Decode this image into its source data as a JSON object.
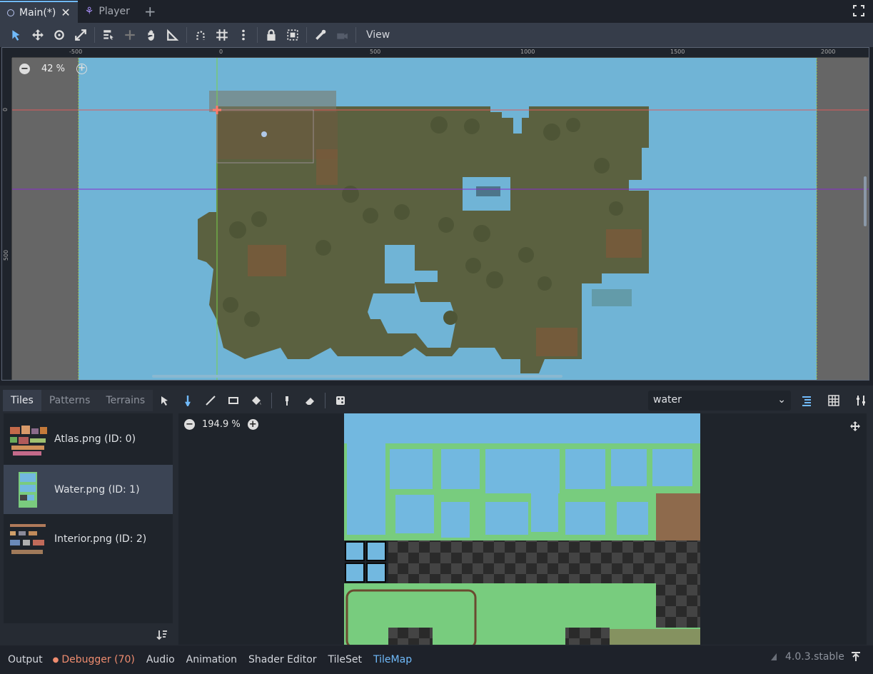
{
  "editor_tabs": {
    "main": "Main(*)",
    "player": "Player"
  },
  "toolbar": {
    "view_label": "View"
  },
  "viewport": {
    "zoom": "42 %",
    "ruler_h": [
      "-500",
      "0",
      "500",
      "1000",
      "1500",
      "2000"
    ],
    "ruler_v": [
      "0",
      "500"
    ]
  },
  "tilemap_panel": {
    "tabs": [
      "Tiles",
      "Patterns",
      "Terrains"
    ],
    "terrain_select": "water",
    "sources": [
      {
        "label": "Atlas.png (ID: 0)"
      },
      {
        "label": "Water.png (ID: 1)"
      },
      {
        "label": "Interior.png (ID: 2)"
      }
    ],
    "atlas_zoom": "194.9 %"
  },
  "bottom_bar": {
    "items": [
      "Output",
      "Debugger (70)",
      "Audio",
      "Animation",
      "Shader Editor",
      "TileSet",
      "TileMap"
    ],
    "version": "4.0.3.stable"
  },
  "colors": {
    "accent": "#70bafa",
    "water": "#70b4d6",
    "grass": "#78cc7e"
  }
}
